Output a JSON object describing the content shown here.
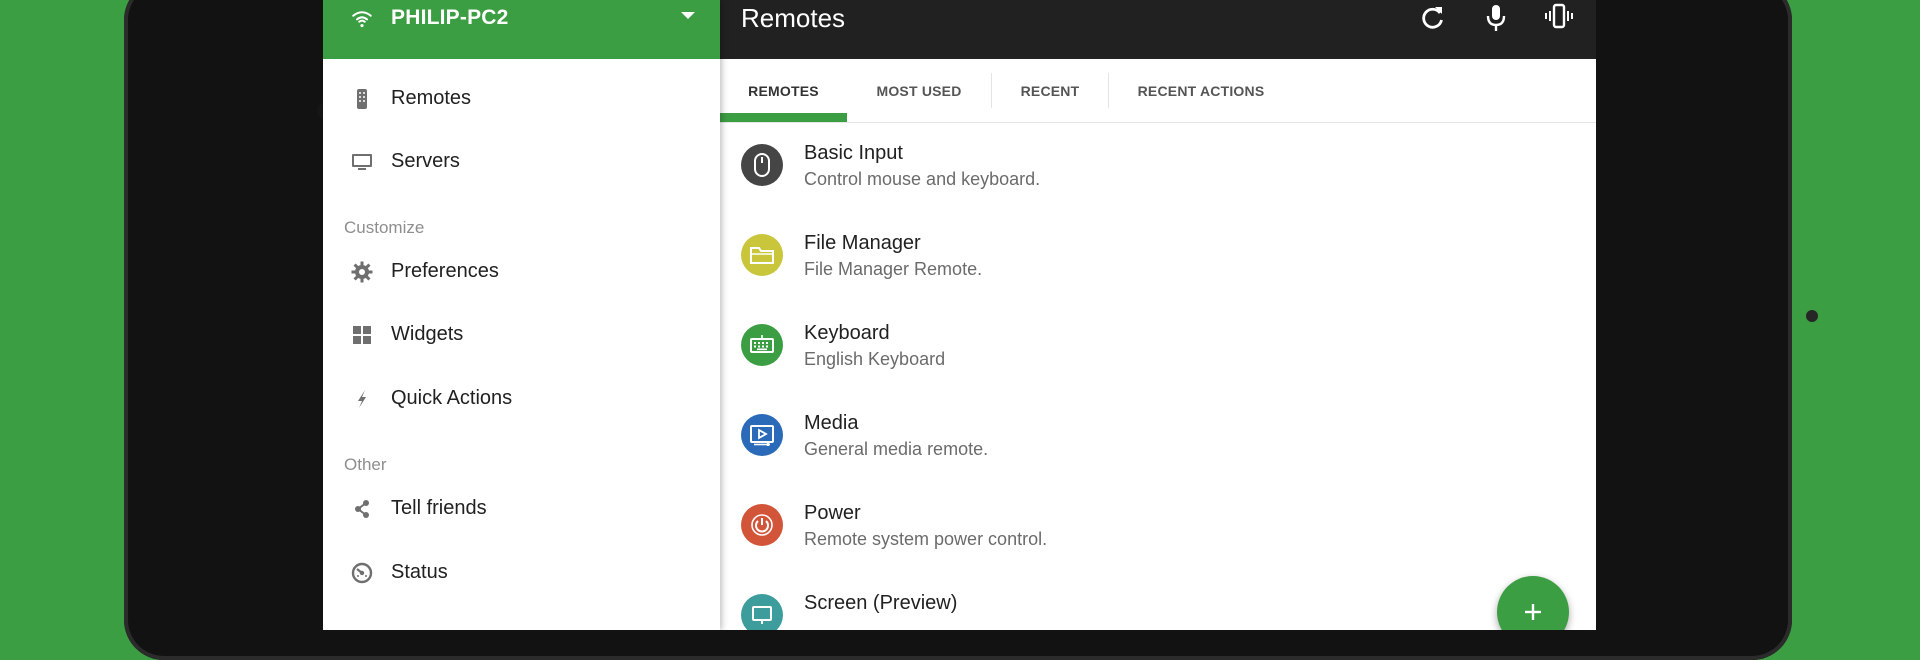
{
  "drawer": {
    "server_name": "PHILIP-PC2",
    "items_top": [
      {
        "label": "Remotes",
        "icon": "remote-icon"
      },
      {
        "label": "Servers",
        "icon": "monitor-icon"
      }
    ],
    "section_customize": "Customize",
    "items_customize": [
      {
        "label": "Preferences",
        "icon": "gear-icon"
      },
      {
        "label": "Widgets",
        "icon": "widgets-icon"
      },
      {
        "label": "Quick Actions",
        "icon": "bolt-icon"
      }
    ],
    "section_other": "Other",
    "items_other": [
      {
        "label": "Tell friends",
        "icon": "share-icon"
      },
      {
        "label": "Status",
        "icon": "status-icon"
      }
    ]
  },
  "toolbar": {
    "title": "Remotes",
    "icons": [
      "refresh-icon",
      "microphone-icon",
      "phone-vibrate-icon"
    ]
  },
  "tabs": [
    "REMOTES",
    "MOST USED",
    "RECENT",
    "RECENT ACTIONS"
  ],
  "active_tab": "REMOTES",
  "remotes": [
    {
      "title": "Basic Input",
      "subtitle": "Control mouse and keyboard.",
      "icon": "mouse-icon",
      "color": "#454545"
    },
    {
      "title": "File Manager",
      "subtitle": "File Manager Remote.",
      "icon": "folder-icon",
      "color": "#c9c63c"
    },
    {
      "title": "Keyboard",
      "subtitle": "English Keyboard",
      "icon": "keyboard-icon",
      "color": "#3c9e43"
    },
    {
      "title": "Media",
      "subtitle": "General media remote.",
      "icon": "media-icon",
      "color": "#2a6ab8"
    },
    {
      "title": "Power",
      "subtitle": "Remote system power control.",
      "icon": "power-icon",
      "color": "#d2553a"
    },
    {
      "title": "Screen (Preview)",
      "subtitle": "",
      "icon": "screen-icon",
      "color": "#3d9c9c"
    }
  ],
  "colors": {
    "accent": "#3c9e43",
    "toolbar": "#212121"
  },
  "fab_icon": "plus-icon"
}
